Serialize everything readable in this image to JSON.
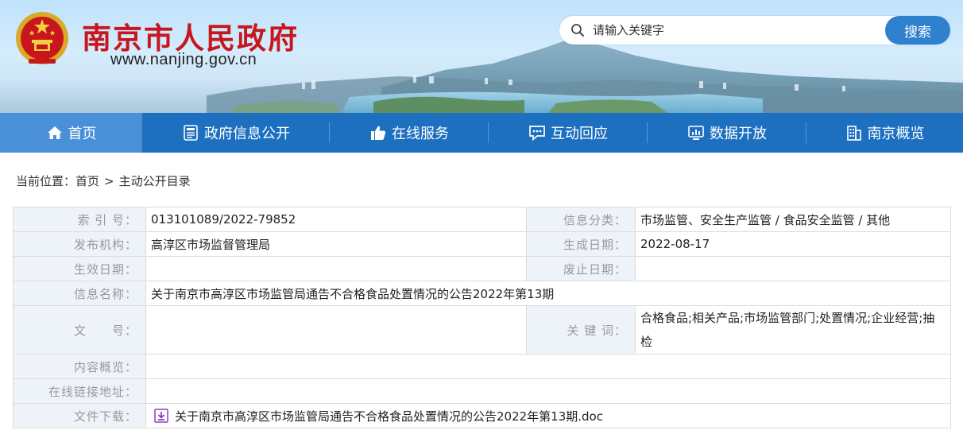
{
  "header": {
    "site_title": "南京市人民政府",
    "site_url": "www.nanjing.gov.cn",
    "search_placeholder": "请输入关键字",
    "search_button": "搜索"
  },
  "nav": {
    "items": [
      {
        "label": "首页",
        "icon": "home-icon"
      },
      {
        "label": "政府信息公开",
        "icon": "document-icon"
      },
      {
        "label": "在线服务",
        "icon": "thumbs-up-icon"
      },
      {
        "label": "互动回应",
        "icon": "chat-icon"
      },
      {
        "label": "数据开放",
        "icon": "monitor-chart-icon"
      },
      {
        "label": "南京概览",
        "icon": "building-icon"
      }
    ]
  },
  "breadcrumb": {
    "prefix": "当前位置：",
    "home": "首页",
    "separator": ">",
    "current": "主动公开目录"
  },
  "meta": {
    "index_no_label": "索 引 号：",
    "index_no": "013101089/2022-79852",
    "category_label": "信息分类：",
    "category": "市场监管、安全生产监管 / 食品安全监管 / 其他",
    "publisher_label": "发布机构：",
    "publisher": "高淳区市场监督管理局",
    "created_label": "生成日期：",
    "created": "2022-08-17",
    "effective_label": "生效日期：",
    "effective": "",
    "abolish_label": "废止日期：",
    "abolish": "",
    "title_label": "信息名称：",
    "title": "关于南京市高淳区市场监管局通告不合格食品处置情况的公告2022年第13期",
    "doc_no_label": "文　　号：",
    "doc_no": "",
    "keywords_label": "关 键 词：",
    "keywords": "合格食品;相关产品;市场监管部门;处置情况;企业经营;抽检",
    "summary_label": "内容概览：",
    "summary": "",
    "link_label": "在线链接地址：",
    "link": "",
    "download_label": "文件下载：",
    "download_file": "关于南京市高淳区市场监管局通告不合格食品处置情况的公告2022年第13期.doc"
  },
  "colors": {
    "brand_red": "#c8161d",
    "nav_blue": "#1d70c0",
    "nav_active": "#4a90d9",
    "search_button": "#2f80cf",
    "label_bg": "#eef3fa"
  }
}
